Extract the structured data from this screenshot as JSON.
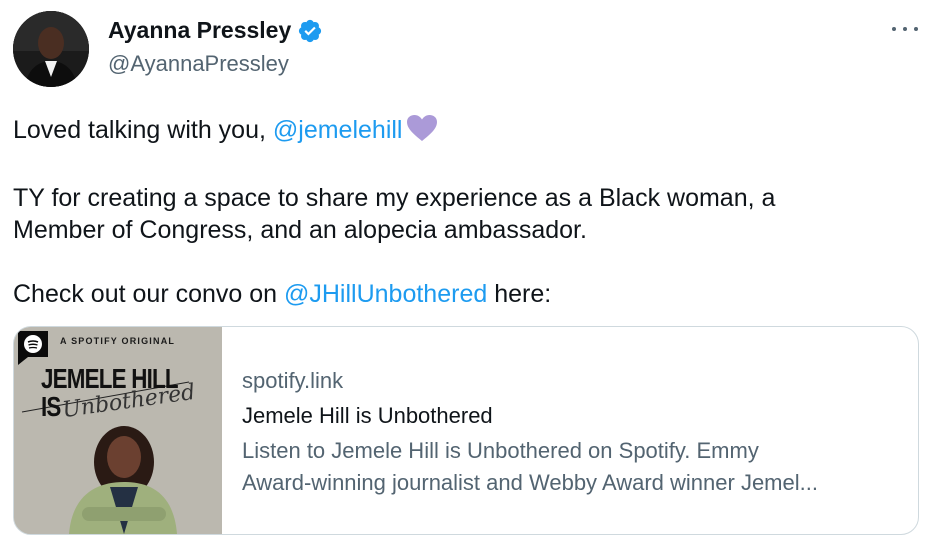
{
  "author": {
    "display_name": "Ayanna Pressley",
    "handle": "@AyannaPressley",
    "verified": true
  },
  "tweet": {
    "line1_text": "Loved talking with you, ",
    "line1_mention": "@jemelehill",
    "line1_emoji": "purple-heart",
    "paragraph2": "TY for creating a space to share my experience as a Black woman, a Member of Congress, and an alopecia ambassador.",
    "paragraph2_line1": "TY for creating a space to share my experience as a Black woman, a",
    "paragraph2_line2": "Member of Congress, and an alopecia ambassador.",
    "line3_prefix": "Check out our convo on ",
    "line3_mention": "@JHillUnbothered",
    "line3_suffix": " here:"
  },
  "link_card": {
    "domain": "spotify.link",
    "title": "Jemele Hill is Unbothered",
    "description_line1": "Listen to Jemele Hill is Unbothered on Spotify. Emmy",
    "description_line2": "Award-winning journalist and Webby Award winner Jemel...",
    "thumbnail": {
      "badge": "A SPOTIFY ORIGINAL",
      "title": "JEMELE HILL IS",
      "subtitle": "Unbothered"
    }
  },
  "colors": {
    "link": "#1d9bf0",
    "secondary_text": "#536471",
    "border": "#cfd9de",
    "verified": "#1d9bf0",
    "heart": "#ab9ad8"
  },
  "icons": {
    "more": "more-horizontal-icon",
    "verified": "verified-badge-icon",
    "spotify": "spotify-logo-icon"
  }
}
